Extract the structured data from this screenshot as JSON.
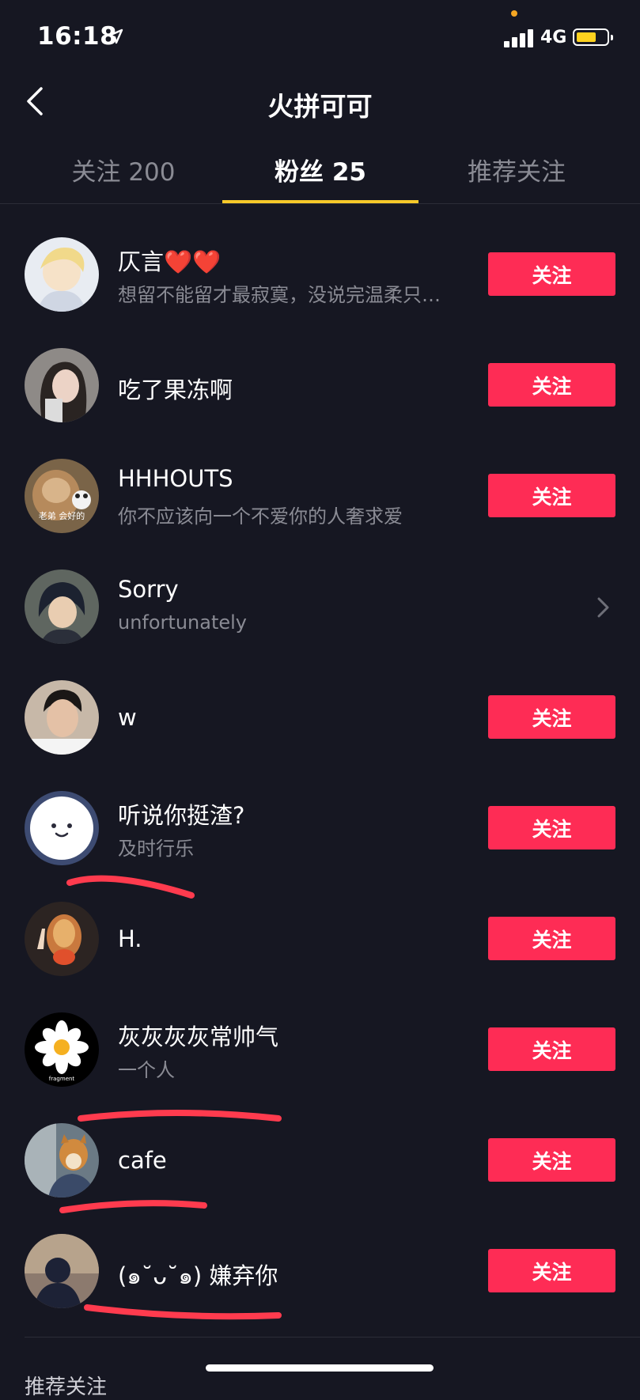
{
  "status": {
    "time": "16:18",
    "network": "4G",
    "accent_dot": "#f5a623",
    "battery_color": "#ffd21f"
  },
  "nav": {
    "title": "火拼可可",
    "back_icon": "chevron-left-icon"
  },
  "tabs": [
    {
      "label": "关注 200",
      "active": false
    },
    {
      "label": "粉丝 25",
      "active": true
    },
    {
      "label": "推荐关注",
      "active": false
    }
  ],
  "colors": {
    "background": "#161722",
    "follow_button": "#fe2c55",
    "tab_indicator": "#f7c92a",
    "annotation_line": "#ff3b4e"
  },
  "followers": [
    {
      "name": "仄言❤️❤️",
      "bio": "想留不能留才最寂寞，没说完温柔只…",
      "action": "关注"
    },
    {
      "name": "吃了果冻啊",
      "bio": "",
      "action": "关注"
    },
    {
      "name": "HHHOUTS",
      "bio": "你不应该向一个不爱你的人奢求爱",
      "action": "关注",
      "avatar_caption": "老弟 会好的"
    },
    {
      "name": "Sorry",
      "bio": "unfortunately",
      "action": ""
    },
    {
      "name": "w",
      "bio": "",
      "action": "关注"
    },
    {
      "name": "听说你挺渣?",
      "bio": "及时行乐",
      "action": "关注"
    },
    {
      "name": "H.",
      "bio": "",
      "action": "关注"
    },
    {
      "name": "灰灰灰灰常帅气",
      "bio": "一个人",
      "action": "关注",
      "avatar_caption": "fragment"
    },
    {
      "name": "cafe",
      "bio": "",
      "action": "关注"
    },
    {
      "name": "(๑˘ᴗ˘๑) 嫌弃你",
      "bio": "",
      "action": "关注"
    }
  ],
  "footer": {
    "section_label": "推荐关注"
  }
}
